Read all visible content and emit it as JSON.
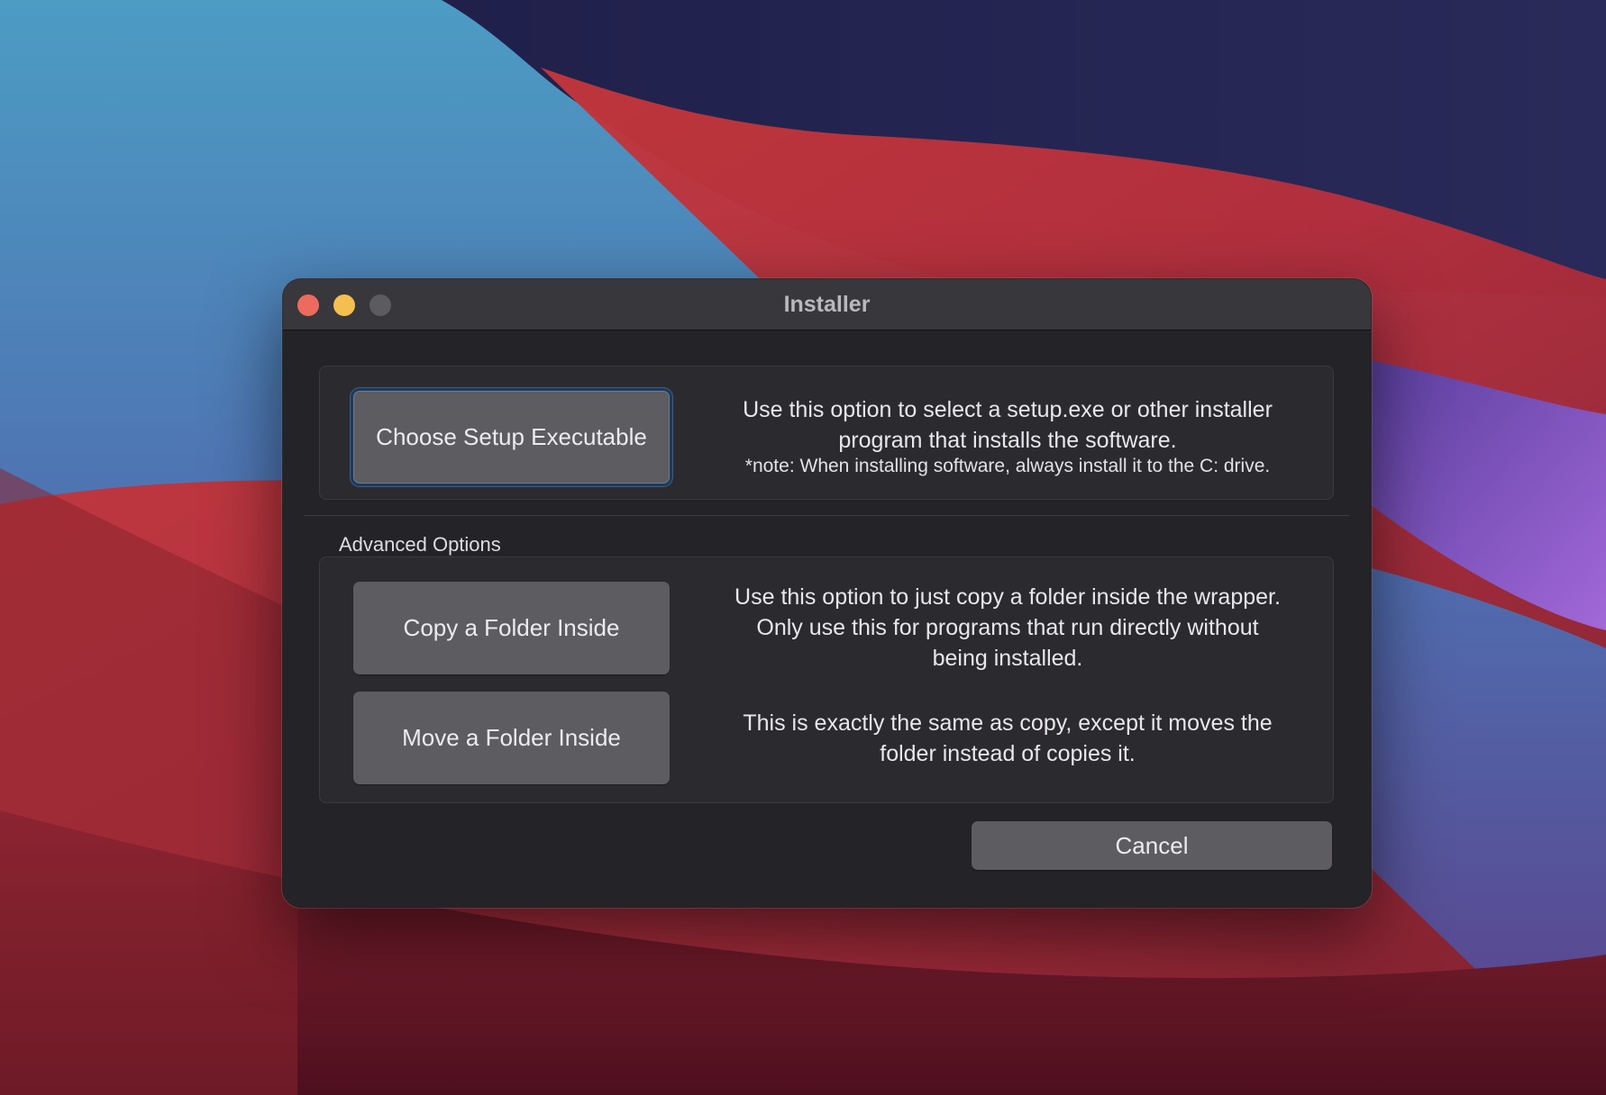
{
  "window": {
    "title": "Installer"
  },
  "primary": {
    "button_label": "Choose Setup Executable",
    "description_line1": "Use this option to select a setup.exe or other installer",
    "description_line2": "program that installs the software.",
    "note": "*note: When installing software, always install it to the C: drive."
  },
  "advanced": {
    "label": "Advanced Options",
    "copy": {
      "button_label": "Copy a Folder Inside",
      "description_line1": "Use this option to just copy a folder inside the wrapper.",
      "description_line2": "Only use this for programs that run directly without",
      "description_line3": "being installed."
    },
    "move": {
      "button_label": "Move a Folder Inside",
      "description_line1": "This is exactly the same as copy, except it moves the",
      "description_line2": "folder instead of copies it."
    }
  },
  "footer": {
    "cancel_label": "Cancel"
  },
  "icons": {
    "close": "close-icon",
    "minimize": "minimize-icon",
    "maximize": "maximize-icon"
  },
  "colors": {
    "close": "#ed6a5e",
    "minimize": "#f4bf4f",
    "maximize_disabled": "#5c5b60",
    "window_bg": "#242327",
    "button_bg": "#5d5c60"
  }
}
